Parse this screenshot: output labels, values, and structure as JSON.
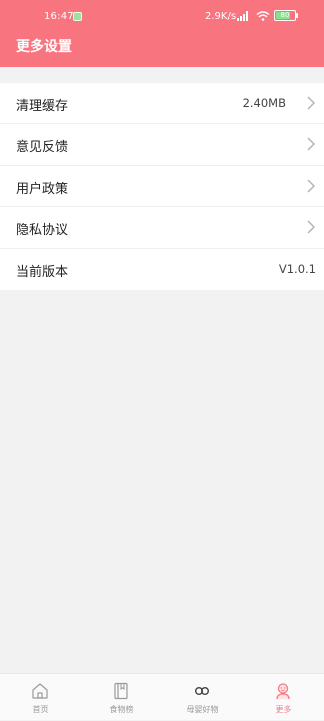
{
  "status_bar": {
    "time": "16:47",
    "network_speed": "2.9K/s",
    "battery_level": "80"
  },
  "header": {
    "title": "更多设置"
  },
  "settings": {
    "items": [
      {
        "label": "清理缓存",
        "value": "2.40MB",
        "has_chevron": true
      },
      {
        "label": "意见反馈",
        "value": "",
        "has_chevron": true
      },
      {
        "label": "用户政策",
        "value": "",
        "has_chevron": true
      },
      {
        "label": "隐私协议",
        "value": "",
        "has_chevron": true
      },
      {
        "label": "当前版本",
        "value": "V1.0.1",
        "has_chevron": false
      }
    ]
  },
  "bottom_nav": {
    "items": [
      {
        "label": "首页",
        "icon": "home-icon",
        "active": false
      },
      {
        "label": "食物榜",
        "icon": "book-icon",
        "active": false
      },
      {
        "label": "母婴好物",
        "icon": "infinity-icon",
        "active": false
      },
      {
        "label": "更多",
        "icon": "person-icon",
        "active": true
      }
    ]
  },
  "colors": {
    "header_bg": "#f8747f",
    "active_tab": "#f27c86",
    "page_bg": "#f2f2f2"
  }
}
